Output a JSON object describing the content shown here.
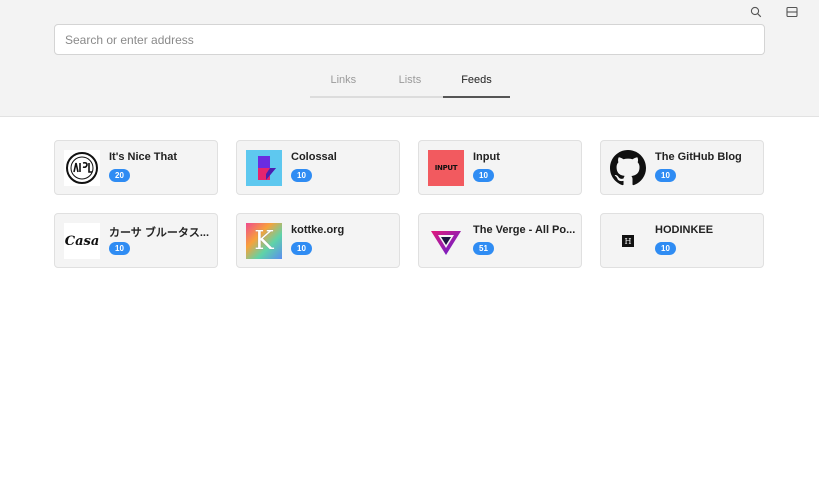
{
  "toolbar": {
    "search_icon": "search-icon",
    "panel_icon": "sidebar-panel-icon"
  },
  "address_bar": {
    "placeholder": "Search or enter address",
    "value": ""
  },
  "tabs": [
    {
      "label": "Links",
      "active": false
    },
    {
      "label": "Lists",
      "active": false
    },
    {
      "label": "Feeds",
      "active": true
    }
  ],
  "feeds": [
    {
      "title": "It's Nice That",
      "count": "20",
      "icon": "nice-that-logo"
    },
    {
      "title": "Colossal",
      "count": "10",
      "icon": "colossal-logo"
    },
    {
      "title": "Input",
      "count": "10",
      "icon": "input-logo",
      "logo_text": "INPUT"
    },
    {
      "title": "The GitHub Blog",
      "count": "10",
      "icon": "github-logo"
    },
    {
      "title": "カーサ ブルータス...",
      "count": "10",
      "icon": "casa-logo",
      "logo_text": "Casa"
    },
    {
      "title": "kottke.org",
      "count": "10",
      "icon": "kottke-logo",
      "logo_text": "K"
    },
    {
      "title": "The Verge - All Po...",
      "count": "51",
      "icon": "verge-logo"
    },
    {
      "title": "HODINKEE",
      "count": "10",
      "icon": "hodinkee-logo",
      "logo_text": "H"
    }
  ],
  "colors": {
    "badge": "#2f8cf3",
    "header_bg": "#f3f3f3",
    "card_bg": "#f4f4f4"
  }
}
